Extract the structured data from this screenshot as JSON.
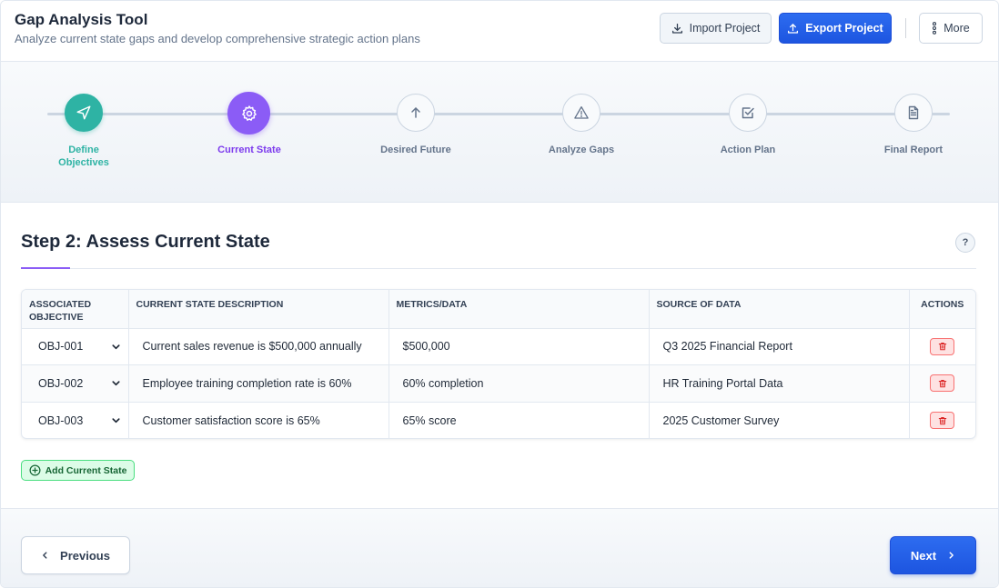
{
  "header": {
    "title": "Gap Analysis Tool",
    "subtitle": "Analyze current state gaps and develop comprehensive strategic action plans",
    "import_label": "Import Project",
    "export_label": "Export Project",
    "more_label": "More"
  },
  "stepper": {
    "steps": [
      {
        "label": "Define Objectives",
        "status": "completed",
        "icon": "send-icon"
      },
      {
        "label": "Current State",
        "status": "active",
        "icon": "gear-icon"
      },
      {
        "label": "Desired Future",
        "status": "pending",
        "icon": "arrow-up-icon"
      },
      {
        "label": "Analyze Gaps",
        "status": "pending",
        "icon": "warning-triangle-icon"
      },
      {
        "label": "Action Plan",
        "status": "pending",
        "icon": "checkbox-icon"
      },
      {
        "label": "Final Report",
        "status": "pending",
        "icon": "document-icon"
      }
    ]
  },
  "main": {
    "title": "Step 2: Assess Current State",
    "help_label": "?",
    "columns": [
      "Associated Objective",
      "Current State Description",
      "Metrics/Data",
      "Source of Data",
      "Actions"
    ],
    "rows": [
      {
        "objective": "OBJ-001",
        "description": "Current sales revenue is $500,000 annually",
        "metrics": "$500,000",
        "source": "Q3 2025 Financial Report"
      },
      {
        "objective": "OBJ-002",
        "description": "Employee training completion rate is 60%",
        "metrics": "60% completion",
        "source": "HR Training Portal Data"
      },
      {
        "objective": "OBJ-003",
        "description": "Customer satisfaction score is 65%",
        "metrics": "65% score",
        "source": "2025 Customer Survey"
      }
    ],
    "add_label": "Add Current State"
  },
  "footer": {
    "previous_label": "Previous",
    "next_label": "Next"
  },
  "colors": {
    "completed": "#2eb3a4",
    "active": "#8b5cf6",
    "primary": "#1d55e0",
    "danger": "#dc2626",
    "success": "#166534"
  }
}
